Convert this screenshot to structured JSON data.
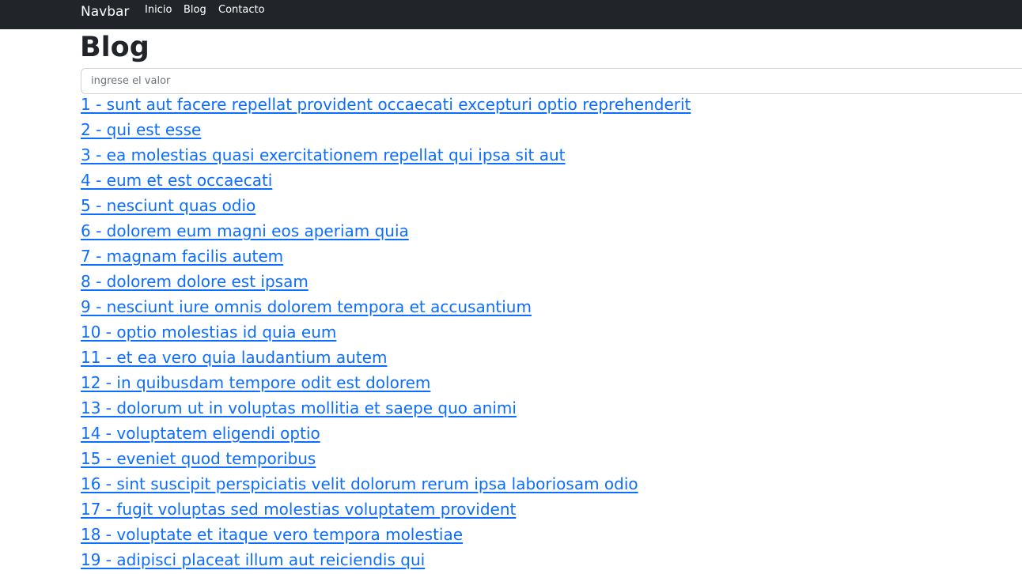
{
  "navbar": {
    "brand": "Navbar",
    "links": [
      "Inicio",
      "Blog",
      "Contacto"
    ],
    "background_color": "#212529"
  },
  "page": {
    "title": "Blog"
  },
  "search": {
    "placeholder": "ingrese el valor",
    "value": ""
  },
  "colors": {
    "link": "#0d6efd",
    "text": "#212529"
  },
  "posts": [
    "1 - sunt aut facere repellat provident occaecati excepturi optio reprehenderit",
    "2 - qui est esse",
    "3 - ea molestias quasi exercitationem repellat qui ipsa sit aut",
    "4 - eum et est occaecati",
    "5 - nesciunt quas odio",
    "6 - dolorem eum magni eos aperiam quia",
    "7 - magnam facilis autem",
    "8 - dolorem dolore est ipsam",
    "9 - nesciunt iure omnis dolorem tempora et accusantium",
    "10 - optio molestias id quia eum",
    "11 - et ea vero quia laudantium autem",
    "12 - in quibusdam tempore odit est dolorem",
    "13 - dolorum ut in voluptas mollitia et saepe quo animi",
    "14 - voluptatem eligendi optio",
    "15 - eveniet quod temporibus",
    "16 - sint suscipit perspiciatis velit dolorum rerum ipsa laboriosam odio",
    "17 - fugit voluptas sed molestias voluptatem provident",
    "18 - voluptate et itaque vero tempora molestiae",
    "19 - adipisci placeat illum aut reiciendis qui"
  ]
}
